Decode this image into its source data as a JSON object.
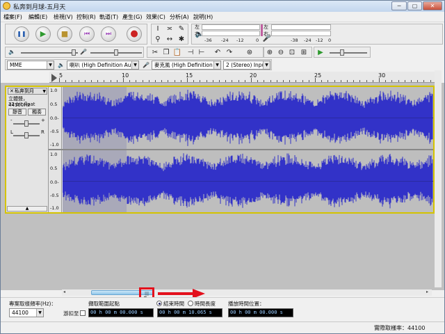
{
  "window": {
    "title": "私奔到月球-五月天",
    "controls": {
      "minimize": "─",
      "maximize": "▢",
      "close": "✕"
    }
  },
  "menu": [
    "檔案(F)",
    "編輯(E)",
    "檢視(V)",
    "控制(R)",
    "軌道(T)",
    "產生(G)",
    "效果(C)",
    "分析(A)",
    "說明(H)"
  ],
  "transport": {
    "pause": "❚❚",
    "play": "▶",
    "stop": "■",
    "skip_start": "⏮",
    "skip_end": "⏭",
    "record": "●"
  },
  "meters": {
    "left_label": "左",
    "right_label": "右",
    "ticks_play": [
      "-36",
      "-24",
      "-12",
      "0"
    ],
    "ticks_rec": [
      "-38",
      "-24",
      "-12",
      "0"
    ]
  },
  "devices": {
    "host": "MME",
    "output": "喇叭 (High Definition Audic",
    "input": "麥克風 (High Definition Au",
    "channels": "2 (Stereo) Inpu"
  },
  "ruler": {
    "labels": [
      "5",
      "10",
      "15",
      "20",
      "25",
      "30"
    ]
  },
  "track": {
    "close": "✕",
    "name": "私奔到月",
    "dropdown": "▼",
    "info_line1": "立體聲，44100Hz",
    "info_line2": "32-bit float",
    "mute": "靜音",
    "solo": "獨奏",
    "gain_minus": "-",
    "gain_plus": "+",
    "pan_left": "L",
    "pan_right": "R",
    "collapse": "▲",
    "scale": [
      "1.0",
      "0.5",
      "0.0-",
      "-0.5",
      "-1.0"
    ]
  },
  "scroll": {
    "left_arrow": "◂",
    "right_arrow": "▸",
    "grip": "|||"
  },
  "selection_bar": {
    "rate_label": "專案取樣頻率(Hz)：",
    "rate_value": "44100",
    "snap_label": "游扣至",
    "selection_label": "擷取範圍起點",
    "end_label": "結束時間",
    "length_label": "時間長度",
    "playpos_label": "播放時間位置：",
    "start_time": "00 h 00 m 00.000 s",
    "end_time": "00 h 00 m 10.065 s",
    "play_time": "00 h 00 m 00.000 s"
  },
  "status": {
    "actual_rate": "實際取樣率：44100"
  },
  "colors": {
    "waveform": "#3232c8",
    "selection": "#a9a9b9",
    "annotation": "#e3101c",
    "track_border": "#d4c300"
  }
}
